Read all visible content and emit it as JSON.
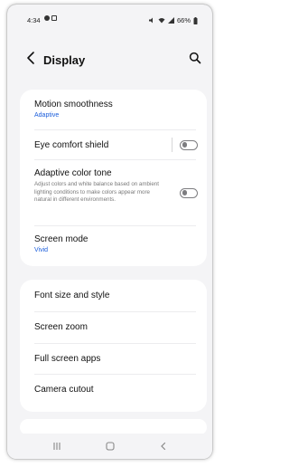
{
  "status_bar": {
    "time": "4:34",
    "battery": "66%"
  },
  "header": {
    "title": "Display"
  },
  "group1": {
    "motion_smoothness": {
      "label": "Motion smoothness",
      "value": "Adaptive"
    },
    "eye_comfort": {
      "label": "Eye comfort shield",
      "enabled": false
    },
    "adaptive_color": {
      "label": "Adaptive color tone",
      "description": "Adjust colors and white balance based on ambient lighting conditions to make colors appear more natural in different environments.",
      "enabled": false
    },
    "screen_mode": {
      "label": "Screen mode",
      "value": "Vivid"
    }
  },
  "group2": {
    "items": [
      {
        "label": "Font size and style"
      },
      {
        "label": "Screen zoom"
      },
      {
        "label": "Full screen apps"
      },
      {
        "label": "Camera cutout"
      }
    ]
  },
  "colors": {
    "accent": "#1a5ddb",
    "background": "#f4f4f6",
    "card": "#ffffff",
    "toggle_off": "#7d7d80"
  },
  "icons": {
    "back": "chevron-left-icon",
    "search": "search-icon",
    "nav_recents": "recents-icon",
    "nav_home": "home-icon",
    "nav_back": "nav-back-icon"
  }
}
